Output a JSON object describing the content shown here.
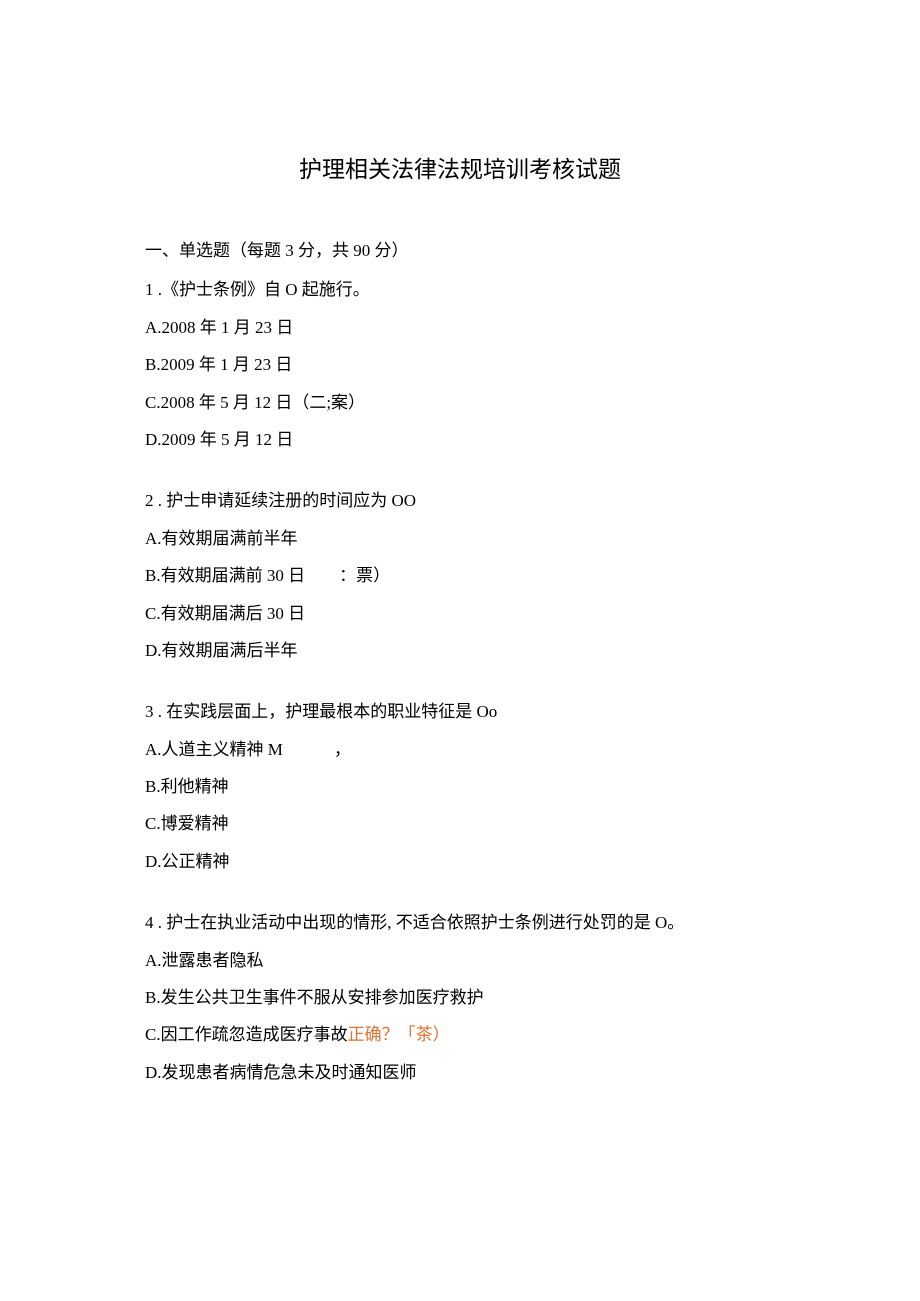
{
  "title": "护理相关法律法规培训考核试题",
  "section_header": "一、单选题（每题 3 分，共 90 分）",
  "questions": [
    {
      "stem": "1 .《护士条例》自 O 起施行。",
      "options": [
        "A.2008 年 1 月 23 日",
        "B.2009 年 1 月 23 日",
        "C.2008 年 5 月 12 日（二;案）",
        "D.2009 年 5 月 12 日"
      ]
    },
    {
      "stem": "2  . 护士申请延续注册的时间应为 OO",
      "options": [
        "A.有效期届满前半年",
        "B.有效期届满前 30 日  ：票）",
        "C.有效期届满后 30 日",
        "D.有效期届满后半年"
      ]
    },
    {
      "stem": "3  . 在实践层面上，护理最根本的职业特征是 Oo",
      "options": [
        "A.人道主义精神 M   ，",
        "B.利他精神",
        "C.博爱精神",
        "D.公正精神"
      ]
    },
    {
      "stem": "4  . 护士在执业活动中出现的情形, 不适合依照护士条例进行处罚的是 O。",
      "options": [
        "A.泄露患者隐私",
        "B.发生公共卫生事件不服从安排参加医疗救护",
        "C.因工作疏忽造成医疗事故",
        "D.发现患者病情危急未及时通知医师"
      ],
      "option_c_suffix": "正确？「茶）"
    }
  ]
}
